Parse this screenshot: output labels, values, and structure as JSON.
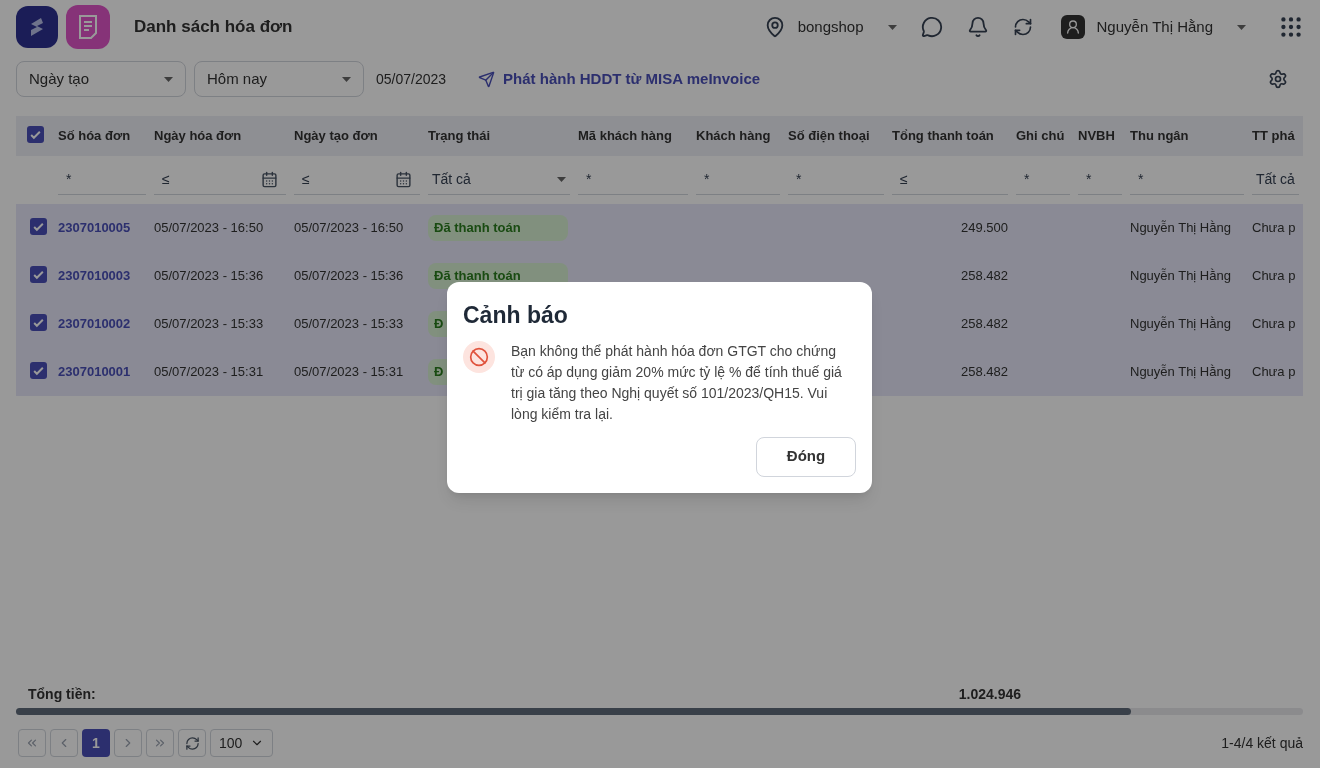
{
  "header": {
    "title": "Danh sách hóa đơn",
    "store": "bongshop",
    "user": "Nguyễn Thị Hằng"
  },
  "filters": {
    "date_field": "Ngày tạo",
    "range": "Hôm nay",
    "date": "05/07/2023",
    "publish_link": "Phát hành HDDT từ MISA meInvoice"
  },
  "table": {
    "all_selected": true,
    "columns": [
      {
        "label": "Số hóa đơn"
      },
      {
        "label": "Ngày hóa đơn"
      },
      {
        "label": "Ngày tạo đơn"
      },
      {
        "label": "Trạng thái"
      },
      {
        "label": "Mã khách hàng"
      },
      {
        "label": "Khách hàng"
      },
      {
        "label": "Số điện thoại"
      },
      {
        "label": "Tổng thanh toán"
      },
      {
        "label": "Ghi chú"
      },
      {
        "label": "NVBH"
      },
      {
        "label": "Thu ngân"
      },
      {
        "label": "TT phá"
      }
    ],
    "column_filters": [
      {
        "kind": "text",
        "placeholder": "*"
      },
      {
        "kind": "date",
        "placeholder": "≤"
      },
      {
        "kind": "date",
        "placeholder": "≤"
      },
      {
        "kind": "select",
        "value": "Tất cả"
      },
      {
        "kind": "text",
        "placeholder": "*"
      },
      {
        "kind": "text",
        "placeholder": "*"
      },
      {
        "kind": "text",
        "placeholder": "*"
      },
      {
        "kind": "text",
        "placeholder": "≤"
      },
      {
        "kind": "text",
        "placeholder": "*"
      },
      {
        "kind": "text",
        "placeholder": "*"
      },
      {
        "kind": "text",
        "placeholder": "*"
      },
      {
        "kind": "select",
        "value": "Tất cả"
      }
    ],
    "rows": [
      {
        "selected": true,
        "invoice": "2307010005",
        "invoice_date": "05/07/2023 - 16:50",
        "created": "05/07/2023 - 16:50",
        "status": "Đã thanh toán",
        "amount": "249.500",
        "cashier": "Nguyễn Thị Hằng",
        "payment": "Chưa p"
      },
      {
        "selected": true,
        "invoice": "2307010003",
        "invoice_date": "05/07/2023 - 15:36",
        "created": "05/07/2023 - 15:36",
        "status": "Đã thanh toán",
        "amount": "258.482",
        "cashier": "Nguyễn Thị Hằng",
        "payment": "Chưa p"
      },
      {
        "selected": true,
        "invoice": "2307010002",
        "invoice_date": "05/07/2023 - 15:33",
        "created": "05/07/2023 - 15:33",
        "status": "Đ",
        "amount": "258.482",
        "cashier": "Nguyễn Thị Hằng",
        "payment": "Chưa p"
      },
      {
        "selected": true,
        "invoice": "2307010001",
        "invoice_date": "05/07/2023 - 15:31",
        "created": "05/07/2023 - 15:31",
        "status": "Đ",
        "amount": "258.482",
        "cashier": "Nguyễn Thị Hằng",
        "payment": "Chưa p"
      }
    ]
  },
  "footer": {
    "total_label": "Tổng tiền:",
    "total": "1.024.946"
  },
  "pagination": {
    "pages": [
      {
        "label": "1",
        "selected": true
      }
    ],
    "page_size": "100",
    "summary": "1-4/4 kết quả"
  },
  "dialog": {
    "title": "Cảnh báo",
    "message": "Bạn không thể phát hành hóa đơn GTGT cho chứng từ có áp dụng giảm 20% mức tỷ lệ % để tính thuế giá trị gia tăng theo Nghị quyết số 101/2023/QH15. Vui lòng kiểm tra lại.",
    "button": "Đóng"
  }
}
